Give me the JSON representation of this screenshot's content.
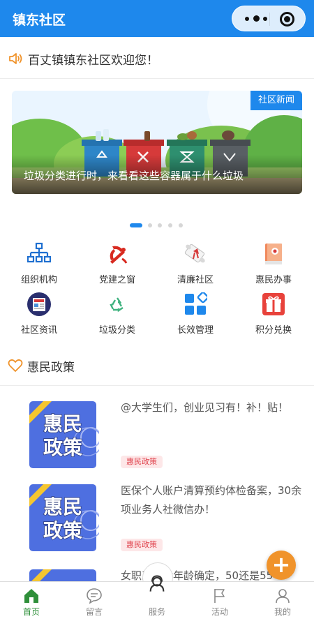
{
  "app": {
    "title": "镇东社区"
  },
  "notice": {
    "text": "百丈镇镇东社区欢迎您！"
  },
  "banner": {
    "tag": "社区新闻",
    "caption": "垃圾分类进行时，来看看这些容器属于什么垃圾",
    "pages": 5,
    "active_page": 1
  },
  "grid": [
    {
      "label": "组织机构",
      "icon": "org-chart-icon"
    },
    {
      "label": "党建之窗",
      "icon": "party-emblem-icon"
    },
    {
      "label": "清廉社区",
      "icon": "scroll-icon"
    },
    {
      "label": "惠民办事",
      "icon": "book-icon"
    },
    {
      "label": "社区资讯",
      "icon": "news-icon"
    },
    {
      "label": "垃圾分类",
      "icon": "recycle-icon"
    },
    {
      "label": "长效管理",
      "icon": "blocks-icon"
    },
    {
      "label": "积分兑换",
      "icon": "gift-icon"
    }
  ],
  "section": {
    "title": "惠民政策"
  },
  "thumb_text": {
    "line1": "惠民",
    "line2": "政策"
  },
  "policies": [
    {
      "title": "@大学生们，创业见习有！补！贴！",
      "badge": "惠民政策"
    },
    {
      "title": "医保个人账户清算预约体检备案，30余项业务人社微信办！",
      "badge": "惠民政策"
    },
    {
      "title": "女职工退休年龄确定，50还是55",
      "badge": ""
    }
  ],
  "tabs": [
    {
      "label": "首页",
      "icon": "home-icon"
    },
    {
      "label": "留言",
      "icon": "message-icon"
    },
    {
      "label": "服务",
      "icon": "service-icon"
    },
    {
      "label": "活动",
      "icon": "flag-icon"
    },
    {
      "label": "我的",
      "icon": "user-icon"
    }
  ],
  "colors": {
    "primary": "#1e88ec",
    "active_tab": "#2f8f3a",
    "badge": "#e0444e",
    "fab": "#f0932b",
    "heart": "#f0932b"
  }
}
